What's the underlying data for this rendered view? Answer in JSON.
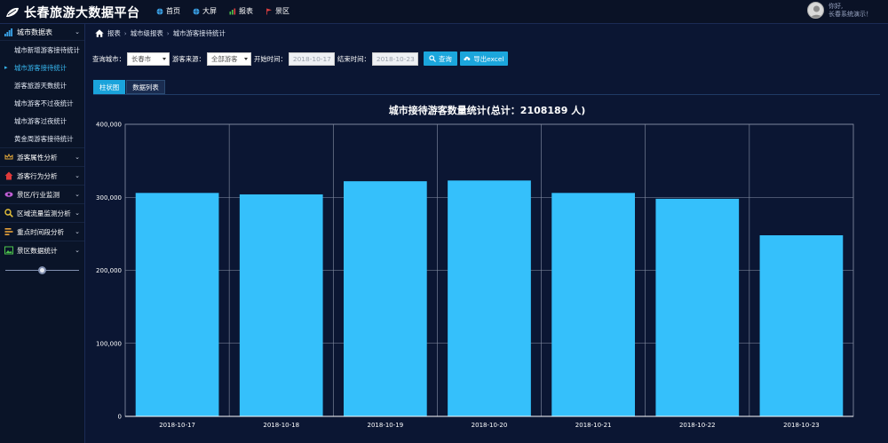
{
  "app": {
    "title": "长春旅游大数据平台"
  },
  "nav": [
    {
      "label": "首页",
      "icon": "globe-icon",
      "color": "#3aa3e8"
    },
    {
      "label": "大屏",
      "icon": "globe-icon",
      "color": "#3aa3e8"
    },
    {
      "label": "报表",
      "icon": "bar-chart-icon",
      "color": "#4cc34c"
    },
    {
      "label": "景区",
      "icon": "flag-icon",
      "color": "#e04040"
    }
  ],
  "user": {
    "greeting": "你好,",
    "name": "长春系统演示！"
  },
  "sidebar": {
    "header": {
      "label": "城市数据表",
      "icon": "signal-bars-icon"
    },
    "subitems": [
      {
        "label": "城市新增游客接待统计",
        "active": false
      },
      {
        "label": "城市游客接待统计",
        "active": true
      },
      {
        "label": "游客旅游天数统计",
        "active": false
      },
      {
        "label": "城市游客不过夜统计",
        "active": false
      },
      {
        "label": "城市游客过夜统计",
        "active": false
      },
      {
        "label": "黄金周游客接待统计",
        "active": false
      }
    ],
    "groups": [
      {
        "label": "游客属性分析",
        "icon": "crown-icon",
        "color": "#e0a63a"
      },
      {
        "label": "游客行为分析",
        "icon": "home-icon",
        "color": "#e03a3a"
      },
      {
        "label": "景区/行业监测",
        "icon": "eye-icon",
        "color": "#c25fd6"
      },
      {
        "label": "区域流量监测分析",
        "icon": "search-icon",
        "color": "#e8c23a"
      },
      {
        "label": "重点时间段分析",
        "icon": "list-icon",
        "color": "#e8a23a"
      },
      {
        "label": "景区数据统计",
        "icon": "image-icon",
        "color": "#4cc34c"
      }
    ]
  },
  "breadcrumb": {
    "items": [
      "报表",
      "城市级报表",
      "城市游客接待统计"
    ]
  },
  "filters": {
    "city_label": "查询城市：",
    "city_value": "长春市",
    "source_label": "游客来源：",
    "source_value": "全部游客",
    "start_label": "开始时间：",
    "start_value": "2018-10-17",
    "end_label": "结束时间：",
    "end_value": "2018-10-23",
    "query_label": "查询",
    "export_label": "导出excel"
  },
  "tabs": [
    {
      "label": "柱状图",
      "active": true
    },
    {
      "label": "数据列表",
      "active": false
    }
  ],
  "chart_data": {
    "type": "bar",
    "title": "城市接待游客数量统计(总计：2108189 人)",
    "categories": [
      "2018-10-17",
      "2018-10-18",
      "2018-10-19",
      "2018-10-20",
      "2018-10-21",
      "2018-10-22",
      "2018-10-23"
    ],
    "values": [
      306000,
      304000,
      322000,
      323000,
      306000,
      298000,
      248000
    ],
    "ylim": [
      0,
      400000
    ],
    "yticks": [
      "0",
      "100,000",
      "200,000",
      "300,000",
      "400,000"
    ],
    "xlabel": "",
    "ylabel": "",
    "grid": true,
    "bar_color": "#35c0fb"
  }
}
